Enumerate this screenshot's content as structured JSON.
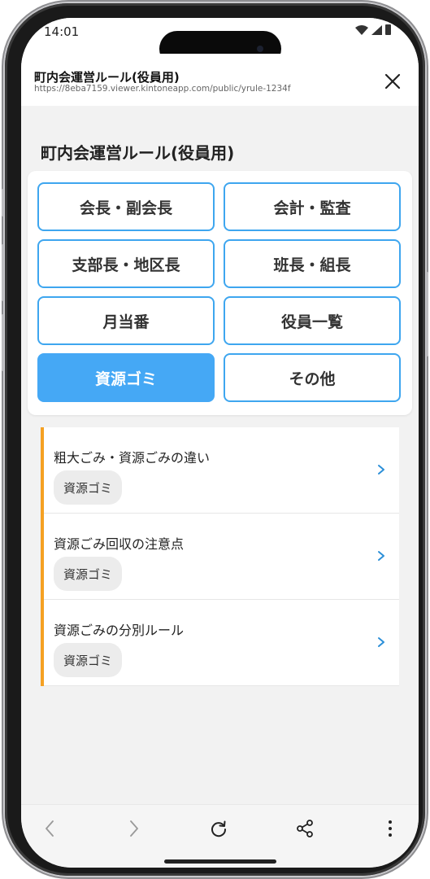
{
  "status_bar": {
    "time": "14:01"
  },
  "webview": {
    "title": "町内会運営ルール(役員用)",
    "url": "https://8eba7159.viewer.kintoneapp.com/public/yrule-1234f"
  },
  "page": {
    "title": "町内会運営ルール(役員用)"
  },
  "categories": [
    {
      "label": "会長・副会長",
      "active": false
    },
    {
      "label": "会計・監査",
      "active": false
    },
    {
      "label": "支部長・地区長",
      "active": false
    },
    {
      "label": "班長・組長",
      "active": false
    },
    {
      "label": "月当番",
      "active": false
    },
    {
      "label": "役員一覧",
      "active": false
    },
    {
      "label": "資源ゴミ",
      "active": true
    },
    {
      "label": "その他",
      "active": false
    }
  ],
  "rules": [
    {
      "title": "粗大ごみ・資源ごみの違い",
      "tag": "資源ゴミ"
    },
    {
      "title": "資源ごみ回収の注意点",
      "tag": "資源ゴミ"
    },
    {
      "title": "資源ごみの分別ルール",
      "tag": "資源ゴミ"
    }
  ],
  "colors": {
    "accent_blue": "#45a8f5",
    "border_blue": "#3ea6ef",
    "list_accent_orange": "#f5a123",
    "chevron_blue": "#2b8fd8"
  },
  "icons": {
    "close": "close-icon",
    "back": "chevron-left-icon",
    "forward": "chevron-right-icon",
    "reload": "reload-icon",
    "share": "share-icon",
    "more": "more-vertical-icon"
  }
}
